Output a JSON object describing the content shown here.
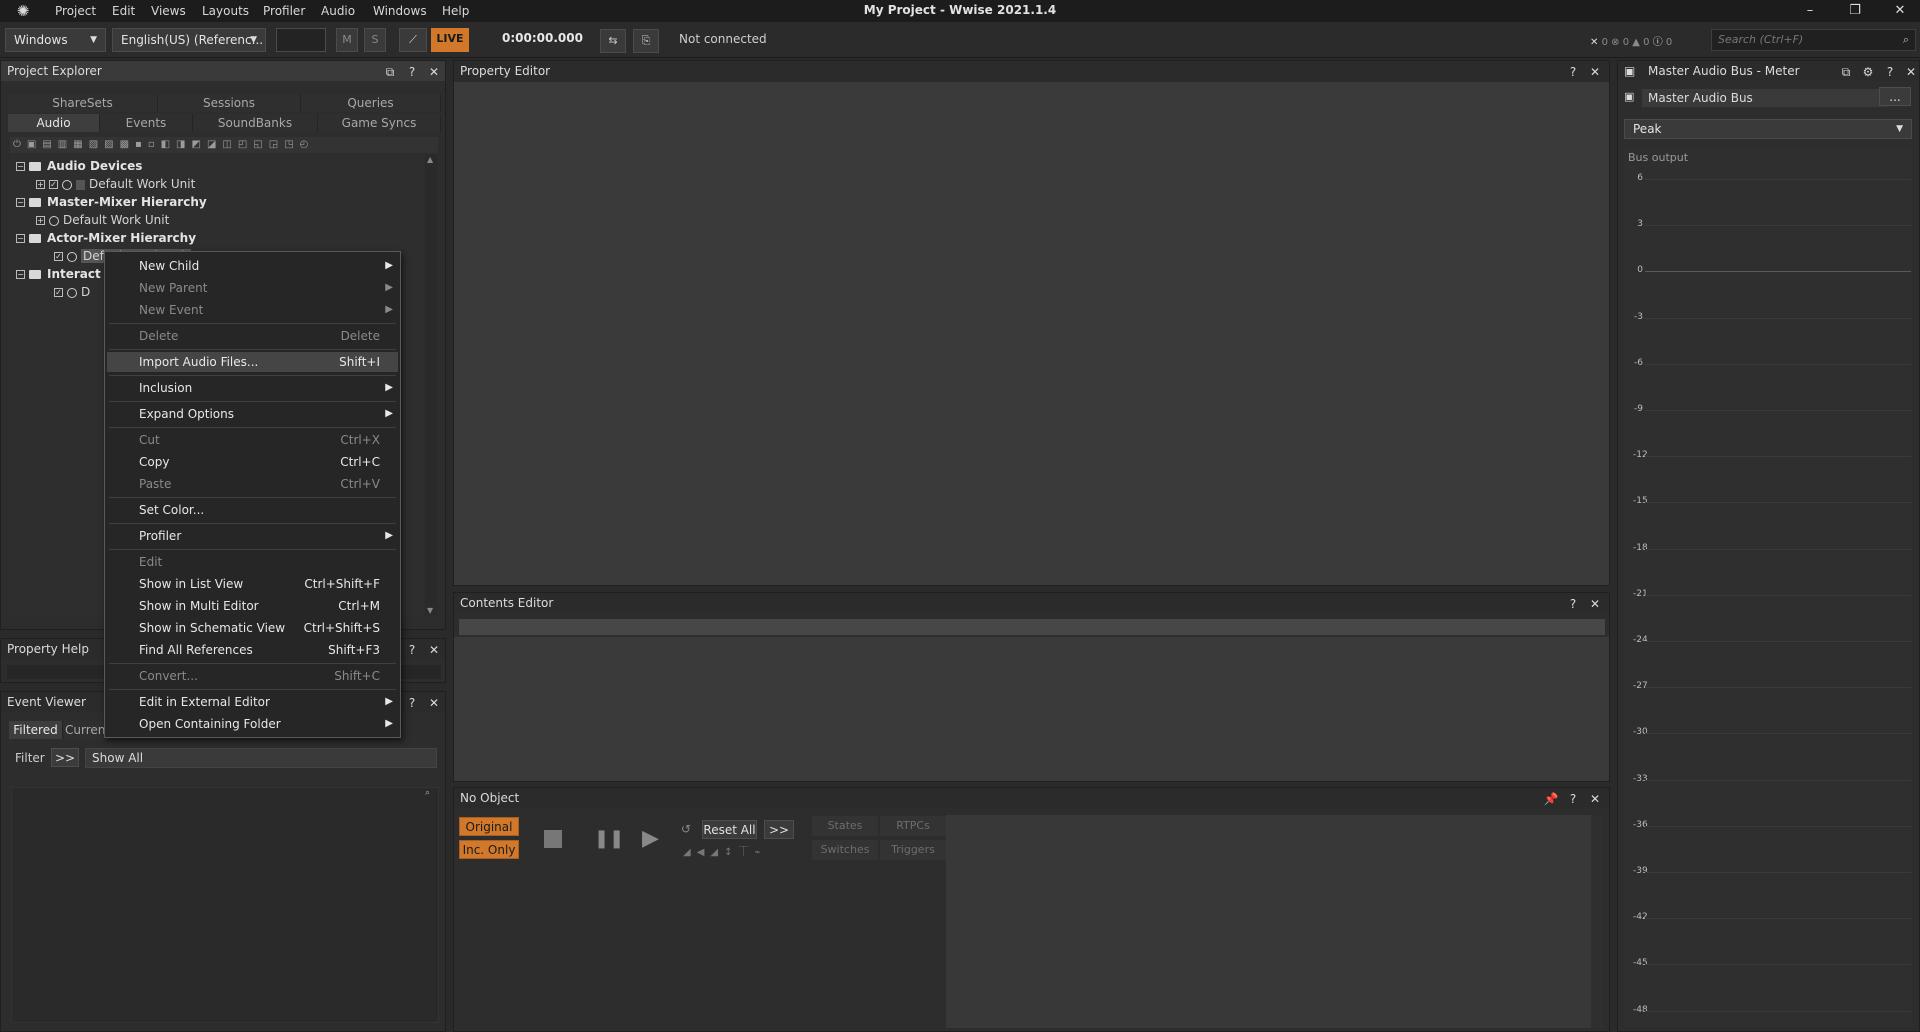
{
  "menubar": {
    "items": [
      "Project",
      "Edit",
      "Views",
      "Layouts",
      "Profiler",
      "Audio",
      "Windows",
      "Help"
    ],
    "title": "My Project - Wwise 2021.1.4"
  },
  "toolbar": {
    "platform": "Windows",
    "language": "English(US) (Referenc...",
    "mute": "M",
    "solo": "S",
    "live": "LIVE",
    "time": "0:00:00.000",
    "status": "Not connected",
    "counts": [
      "0",
      "0",
      "0",
      "0"
    ],
    "search_placeholder": "Search (Ctrl+F)"
  },
  "project_explorer": {
    "title": "Project Explorer",
    "tabs_top": [
      "ShareSets",
      "Sessions",
      "Queries"
    ],
    "tabs_bottom": [
      "Audio",
      "Events",
      "SoundBanks",
      "Game Syncs"
    ],
    "active_tab": "Audio",
    "tree": [
      {
        "label": "Audio Devices",
        "bold": true
      },
      {
        "label": "Default Work Unit",
        "bold": false
      },
      {
        "label": "Master-Mixer Hierarchy",
        "bold": true
      },
      {
        "label": "Default Work Unit",
        "bold": false
      },
      {
        "label": "Actor-Mixer Hierarchy",
        "bold": true
      },
      {
        "label": "Default Work Unit",
        "bold": false
      },
      {
        "label": "Interact",
        "bold": true
      },
      {
        "label": "D",
        "bold": false
      }
    ]
  },
  "context_menu": {
    "items": [
      {
        "label": "New Child",
        "shortcut": "",
        "submenu": true,
        "disabled": false
      },
      {
        "label": "New Parent",
        "shortcut": "",
        "submenu": true,
        "disabled": true
      },
      {
        "label": "New Event",
        "shortcut": "",
        "submenu": true,
        "disabled": true
      },
      {
        "label": "Delete",
        "shortcut": "Delete",
        "submenu": false,
        "disabled": true
      },
      {
        "label": "Import Audio Files...",
        "shortcut": "Shift+I",
        "submenu": false,
        "disabled": false
      },
      {
        "label": "Inclusion",
        "shortcut": "",
        "submenu": true,
        "disabled": false
      },
      {
        "label": "Expand Options",
        "shortcut": "",
        "submenu": true,
        "disabled": false
      },
      {
        "label": "Cut",
        "shortcut": "Ctrl+X",
        "submenu": false,
        "disabled": true
      },
      {
        "label": "Copy",
        "shortcut": "Ctrl+C",
        "submenu": false,
        "disabled": false
      },
      {
        "label": "Paste",
        "shortcut": "Ctrl+V",
        "submenu": false,
        "disabled": true
      },
      {
        "label": "Set Color...",
        "shortcut": "",
        "submenu": false,
        "disabled": false
      },
      {
        "label": "Profiler",
        "shortcut": "",
        "submenu": true,
        "disabled": false
      },
      {
        "label": "Edit",
        "shortcut": "",
        "submenu": false,
        "disabled": true
      },
      {
        "label": "Show in List View",
        "shortcut": "Ctrl+Shift+F",
        "submenu": false,
        "disabled": false
      },
      {
        "label": "Show in Multi Editor",
        "shortcut": "Ctrl+M",
        "submenu": false,
        "disabled": false
      },
      {
        "label": "Show in Schematic View",
        "shortcut": "Ctrl+Shift+S",
        "submenu": false,
        "disabled": false
      },
      {
        "label": "Find All References",
        "shortcut": "Shift+F3",
        "submenu": false,
        "disabled": false
      },
      {
        "label": "Convert...",
        "shortcut": "Shift+C",
        "submenu": false,
        "disabled": true
      },
      {
        "label": "Edit in External Editor",
        "shortcut": "",
        "submenu": true,
        "disabled": false
      },
      {
        "label": "Open Containing Folder",
        "shortcut": "",
        "submenu": true,
        "disabled": false
      }
    ]
  },
  "property_help": {
    "title": "Property Help"
  },
  "event_viewer": {
    "title": "Event Viewer",
    "tabs": [
      "Filtered",
      "Curren"
    ],
    "filter_label": "Filter",
    "filter_btn": ">>",
    "filter_value": "Show All"
  },
  "property_editor": {
    "title": "Property Editor"
  },
  "contents_editor": {
    "title": "Contents Editor"
  },
  "transport": {
    "title": "No Object",
    "original": "Original",
    "inc_only": "Inc. Only",
    "reset_all": "Reset All",
    "more": ">>",
    "tabs": [
      "States",
      "RTPCs",
      "Switches",
      "Triggers"
    ]
  },
  "meter": {
    "title": "Master Audio Bus - Meter",
    "bus": "Master Audio Bus",
    "more": "...",
    "mode": "Peak",
    "section": "Bus output",
    "ticks": [
      "6",
      "3",
      "0",
      "-3",
      "-6",
      "-9",
      "-12",
      "-15",
      "-18",
      "-21",
      "-24",
      "-27",
      "-30",
      "-33",
      "-36",
      "-39",
      "-42",
      "-45",
      "-48"
    ]
  }
}
